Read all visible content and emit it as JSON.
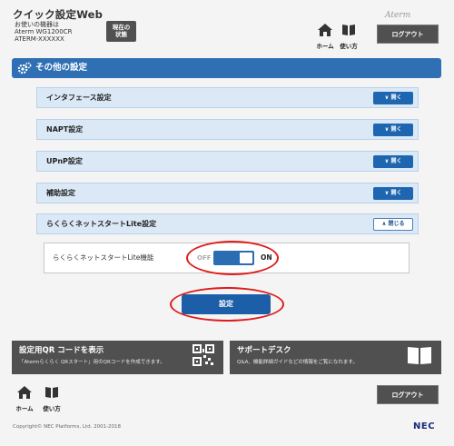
{
  "header": {
    "app_title": "クイック設定Web",
    "device_label": "お使いの機器は",
    "model": "Aterm WG1200CR",
    "device_id": "ATERM-XXXXXX",
    "status_button_line1": "現在の",
    "status_button_line2": "状態",
    "home_label": "ホーム",
    "manual_label": "使い方",
    "brand": "Aterm",
    "logout_label": "ログアウト"
  },
  "section": {
    "title": "その他の設定"
  },
  "panels": [
    {
      "label": "インタフェース設定",
      "button": "開く"
    },
    {
      "label": "NAPT設定",
      "button": "開く"
    },
    {
      "label": "UPnP設定",
      "button": "開く"
    },
    {
      "label": "補助設定",
      "button": "開く"
    },
    {
      "label": "らくらくネットスタートLite設定",
      "button": "閉じる"
    }
  ],
  "toggle": {
    "label": "らくらくネットスタートLite機能",
    "off_label": "OFF",
    "on_label": "ON",
    "state": "ON"
  },
  "setting_button": "設定",
  "tiles": {
    "qr": {
      "title": "設定用QR コードを表示",
      "desc": "「Atermらくらく QRスタート」用のQRコードを作成できます。"
    },
    "support": {
      "title": "サポートデスク",
      "desc": "Q&A、機能詳細ガイドなどの情報をご覧になれます。"
    }
  },
  "footer": {
    "home_label": "ホーム",
    "manual_label": "使い方",
    "logout_label": "ログアウト",
    "copyright": "Copyright© NEC Platforms, Ltd. 2001-2018",
    "nec": "NEC"
  },
  "colors": {
    "accent_blue": "#2f6fb4",
    "panel_bg": "#dbe9f6",
    "dark_button": "#505050",
    "highlight_red": "#e01b1b"
  }
}
